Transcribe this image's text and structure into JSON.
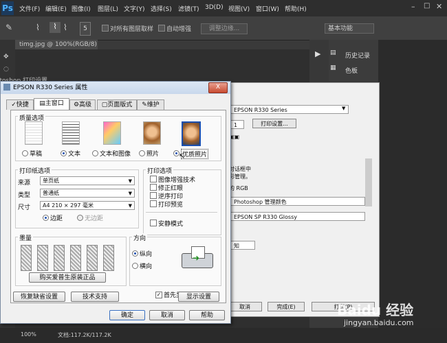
{
  "photoshop": {
    "logo": "Ps",
    "menus": [
      "文件(F)",
      "编辑(E)",
      "图像(I)",
      "图层(L)",
      "文字(Y)",
      "选择(S)",
      "滤镜(T)",
      "3D(D)",
      "视图(V)",
      "窗口(W)",
      "帮助(H)"
    ],
    "brush_size": "5",
    "sample_all_layers": "对所有图层取样",
    "auto_enhance": "自动增强",
    "refine_edge": "调整边缘...",
    "workspace": "基本功能",
    "doc_tab": "timg.jpg @ 100%(RGB/8)",
    "doc_tab_close": "×",
    "panels": {
      "history": "历史记录",
      "swatches": "色板"
    },
    "status": {
      "zoom": "100%",
      "doc": "文档:117.2K/117.2K"
    },
    "print_title_fragment": "otoshop 打印设置"
  },
  "print_settings": {
    "printer": "EPSON R330 Series",
    "copies": "1",
    "print_setup_button": "打印设置...",
    "note_line1": "对话框中",
    "note_line2": "彩管理。",
    "rgb_label": "的 RGB",
    "color_handling": "Photoshop 管理颜色",
    "printer_profile": "EPSON SP R330 Glossy",
    "intent_fragment": "知",
    "cancel": "取消",
    "done": "完成(E)",
    "print": "打印(P)"
  },
  "epson_dialog": {
    "title": "EPSON R330 Series 属性",
    "close": "X",
    "tabs": [
      "快捷",
      "主窗口",
      "高级",
      "页面版式",
      "维护"
    ],
    "active_tab": 1,
    "quality": {
      "label": "质量选项",
      "options": [
        "草稿",
        "文本",
        "文本和图像",
        "照片",
        "优质照片"
      ],
      "selected": 4
    },
    "paper": {
      "label": "打印纸选项",
      "source_label": "来源",
      "source_value": "单页纸",
      "type_label": "类型",
      "type_value": "普通纸",
      "size_label": "尺寸",
      "size_value": "A4 210 × 297 毫米",
      "margins": "边距",
      "borderless": "无边距"
    },
    "print_options": {
      "label": "打印选项",
      "items": [
        "图像增强技术",
        "修正红眼",
        "逆序打印",
        "打印预览"
      ],
      "quiet_mode": "安静模式"
    },
    "ink": {
      "label": "墨量",
      "buy_button": "购买爱普生原装正品"
    },
    "orientation": {
      "label": "方向",
      "portrait": "纵向",
      "landscape": "横向",
      "selected": "portrait"
    },
    "show_first": "首先显示此屏幕",
    "show_first_checked": true,
    "restore_defaults": "恢复缺省设置",
    "tech_support": "技术支持",
    "show_settings": "显示设置",
    "ok": "确定",
    "cancel": "取消",
    "help": "帮助"
  },
  "watermark": {
    "brand": "Baidu 经验",
    "url": "jingyan.baidu.com"
  }
}
